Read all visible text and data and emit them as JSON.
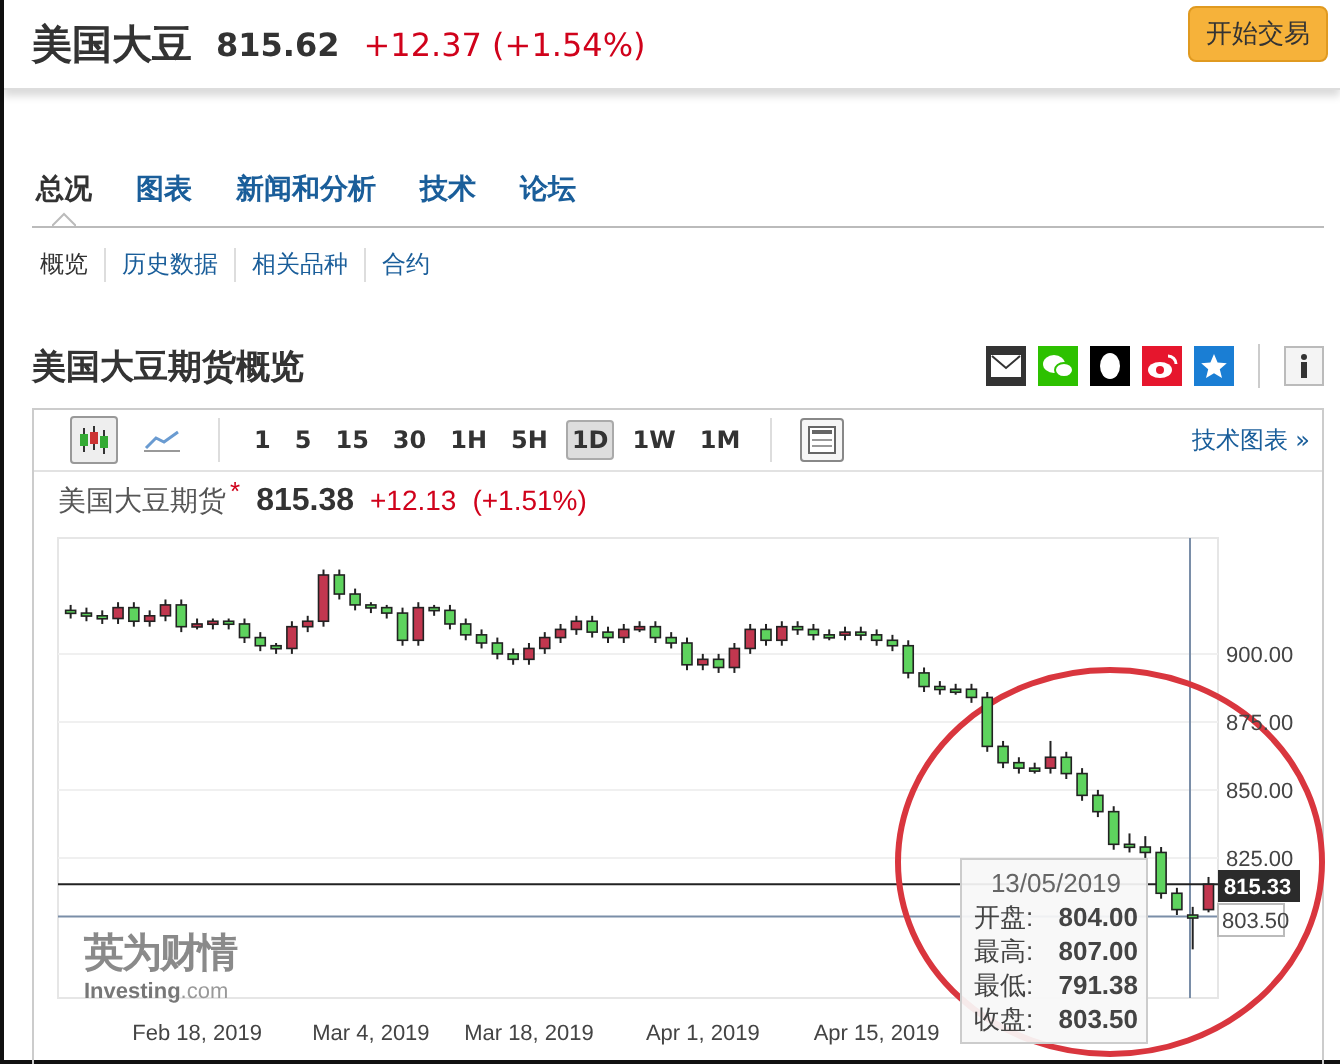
{
  "header": {
    "title": "美国大豆",
    "price": "815.62",
    "change": "+12.37 (+1.54%)",
    "trade_button": "开始交易"
  },
  "tabs": [
    {
      "label": "总况",
      "selected": true
    },
    {
      "label": "图表",
      "selected": false
    },
    {
      "label": "新闻和分析",
      "selected": false
    },
    {
      "label": "技术",
      "selected": false
    },
    {
      "label": "论坛",
      "selected": false
    }
  ],
  "subtabs": [
    {
      "label": "概览",
      "selected": true
    },
    {
      "label": "历史数据",
      "selected": false
    },
    {
      "label": "相关品种",
      "selected": false
    },
    {
      "label": "合约",
      "selected": false
    }
  ],
  "section_title": "美国大豆期货概览",
  "chart": {
    "chart_types": [
      {
        "kind": "candles",
        "selected": true
      },
      {
        "kind": "line",
        "selected": false
      }
    ],
    "timeframes": [
      {
        "label": "1",
        "selected": false
      },
      {
        "label": "5",
        "selected": false
      },
      {
        "label": "15",
        "selected": false
      },
      {
        "label": "30",
        "selected": false
      },
      {
        "label": "1H",
        "selected": false
      },
      {
        "label": "5H",
        "selected": false
      },
      {
        "label": "1D",
        "selected": true
      },
      {
        "label": "1W",
        "selected": false
      },
      {
        "label": "1M",
        "selected": false
      }
    ],
    "link": "技术图表 »",
    "quote": {
      "name": "美国大豆期货",
      "marker": "*",
      "price": "815.38",
      "change": "+12.13",
      "change_pct": "(+1.51%)"
    },
    "chart_data": {
      "type": "candlestick",
      "ohlc": [
        [
          916,
          918,
          913,
          915
        ],
        [
          915,
          917,
          912,
          914
        ],
        [
          914,
          916,
          911,
          913
        ],
        [
          913,
          919,
          911,
          917
        ],
        [
          917,
          919,
          910,
          912
        ],
        [
          912,
          916,
          910,
          914
        ],
        [
          914,
          920,
          912,
          918
        ],
        [
          918,
          920,
          908,
          910
        ],
        [
          910,
          913,
          909,
          911
        ],
        [
          911,
          913,
          909,
          912
        ],
        [
          912,
          913,
          909,
          911
        ],
        [
          911,
          913,
          904,
          906
        ],
        [
          906,
          908,
          901,
          903
        ],
        [
          903,
          904,
          900,
          902
        ],
        [
          902,
          912,
          900,
          910
        ],
        [
          910,
          914,
          908,
          912
        ],
        [
          912,
          931,
          910,
          929
        ],
        [
          929,
          931,
          920,
          922
        ],
        [
          922,
          924,
          916,
          918
        ],
        [
          918,
          919,
          915,
          917
        ],
        [
          917,
          918,
          913,
          915
        ],
        [
          915,
          917,
          903,
          905
        ],
        [
          905,
          919,
          903,
          917
        ],
        [
          917,
          918,
          914,
          916
        ],
        [
          916,
          918,
          909,
          911
        ],
        [
          911,
          913,
          905,
          907
        ],
        [
          907,
          909,
          902,
          904
        ],
        [
          904,
          906,
          898,
          900
        ],
        [
          900,
          902,
          896,
          898
        ],
        [
          898,
          904,
          896,
          902
        ],
        [
          902,
          908,
          900,
          906
        ],
        [
          906,
          911,
          904,
          909
        ],
        [
          909,
          914,
          907,
          912
        ],
        [
          912,
          914,
          906,
          908
        ],
        [
          908,
          910,
          904,
          906
        ],
        [
          906,
          911,
          904,
          909
        ],
        [
          909,
          912,
          908,
          910
        ],
        [
          910,
          912,
          904,
          906
        ],
        [
          906,
          908,
          902,
          904
        ],
        [
          904,
          906,
          894,
          896
        ],
        [
          896,
          900,
          894,
          898
        ],
        [
          898,
          900,
          893,
          895
        ],
        [
          895,
          904,
          893,
          902
        ],
        [
          902,
          911,
          900,
          909
        ],
        [
          909,
          911,
          903,
          905
        ],
        [
          905,
          912,
          903,
          910
        ],
        [
          910,
          912,
          907,
          909
        ],
        [
          909,
          911,
          905,
          907
        ],
        [
          907,
          909,
          905,
          906
        ],
        [
          907,
          910,
          905,
          908
        ],
        [
          908,
          910,
          905,
          907
        ],
        [
          907,
          909,
          903,
          905
        ],
        [
          905,
          907,
          901,
          903
        ],
        [
          903,
          905,
          891,
          893
        ],
        [
          893,
          895,
          886,
          888
        ],
        [
          888,
          890,
          885,
          887
        ],
        [
          887,
          889,
          885,
          886
        ],
        [
          887,
          889,
          882,
          884
        ],
        [
          884,
          886,
          864,
          866
        ],
        [
          866,
          868,
          858,
          860
        ],
        [
          860,
          862,
          856,
          858
        ],
        [
          858,
          860,
          856,
          857
        ],
        [
          858,
          868,
          856,
          862
        ],
        [
          862,
          864,
          854,
          856
        ],
        [
          856,
          858,
          846,
          848
        ],
        [
          848,
          850,
          840,
          842
        ],
        [
          842,
          844,
          828,
          830
        ],
        [
          830,
          834,
          827,
          829
        ],
        [
          829,
          833,
          825,
          827
        ],
        [
          827,
          829,
          810,
          812
        ],
        [
          812,
          814,
          804,
          806
        ],
        [
          804,
          807,
          791.38,
          803.5
        ],
        [
          806,
          818,
          805,
          815.3
        ]
      ],
      "categories": [
        null,
        null,
        null,
        null,
        null,
        null,
        null,
        null,
        "Feb 18, 2019",
        null,
        null,
        null,
        null,
        null,
        null,
        null,
        null,
        null,
        null,
        "Mar 4, 2019",
        null,
        null,
        null,
        null,
        null,
        null,
        null,
        null,
        null,
        "Mar 18, 2019",
        null,
        null,
        null,
        null,
        null,
        null,
        null,
        null,
        null,
        null,
        "Apr 1, 2019",
        null,
        null,
        null,
        null,
        null,
        null,
        null,
        null,
        null,
        null,
        "Apr 15, 2019",
        null,
        null,
        null,
        null,
        null,
        null,
        null,
        null,
        null,
        null,
        null,
        null,
        null,
        null,
        null,
        null,
        null,
        null,
        null,
        null,
        null
      ],
      "ylim": [
        773.5,
        942.6
      ],
      "grid": true,
      "ref_lines": [
        {
          "axis": "y",
          "value": 815.33,
          "color": "#222222"
        },
        {
          "axis": "y",
          "value": 803.5,
          "color": "#7a8ea8"
        }
      ],
      "yticks": [
        {
          "value": 900,
          "label": "900.00"
        },
        {
          "value": 875,
          "label": "875.00"
        },
        {
          "value": 850,
          "label": "850.00"
        },
        {
          "value": 825,
          "label": "825.00"
        }
      ]
    },
    "price_tag": "815.33",
    "crosshair_tag": "803.50",
    "tooltip": {
      "date": "13/05/2019",
      "rows": [
        {
          "label": "开盘:",
          "value": "804.00"
        },
        {
          "label": "最高:",
          "value": "807.00"
        },
        {
          "label": "最低:",
          "value": "791.38"
        },
        {
          "label": "收盘:",
          "value": "803.50"
        }
      ]
    },
    "logo": {
      "name": "英为财情",
      "site": "**Investing**.com"
    }
  }
}
